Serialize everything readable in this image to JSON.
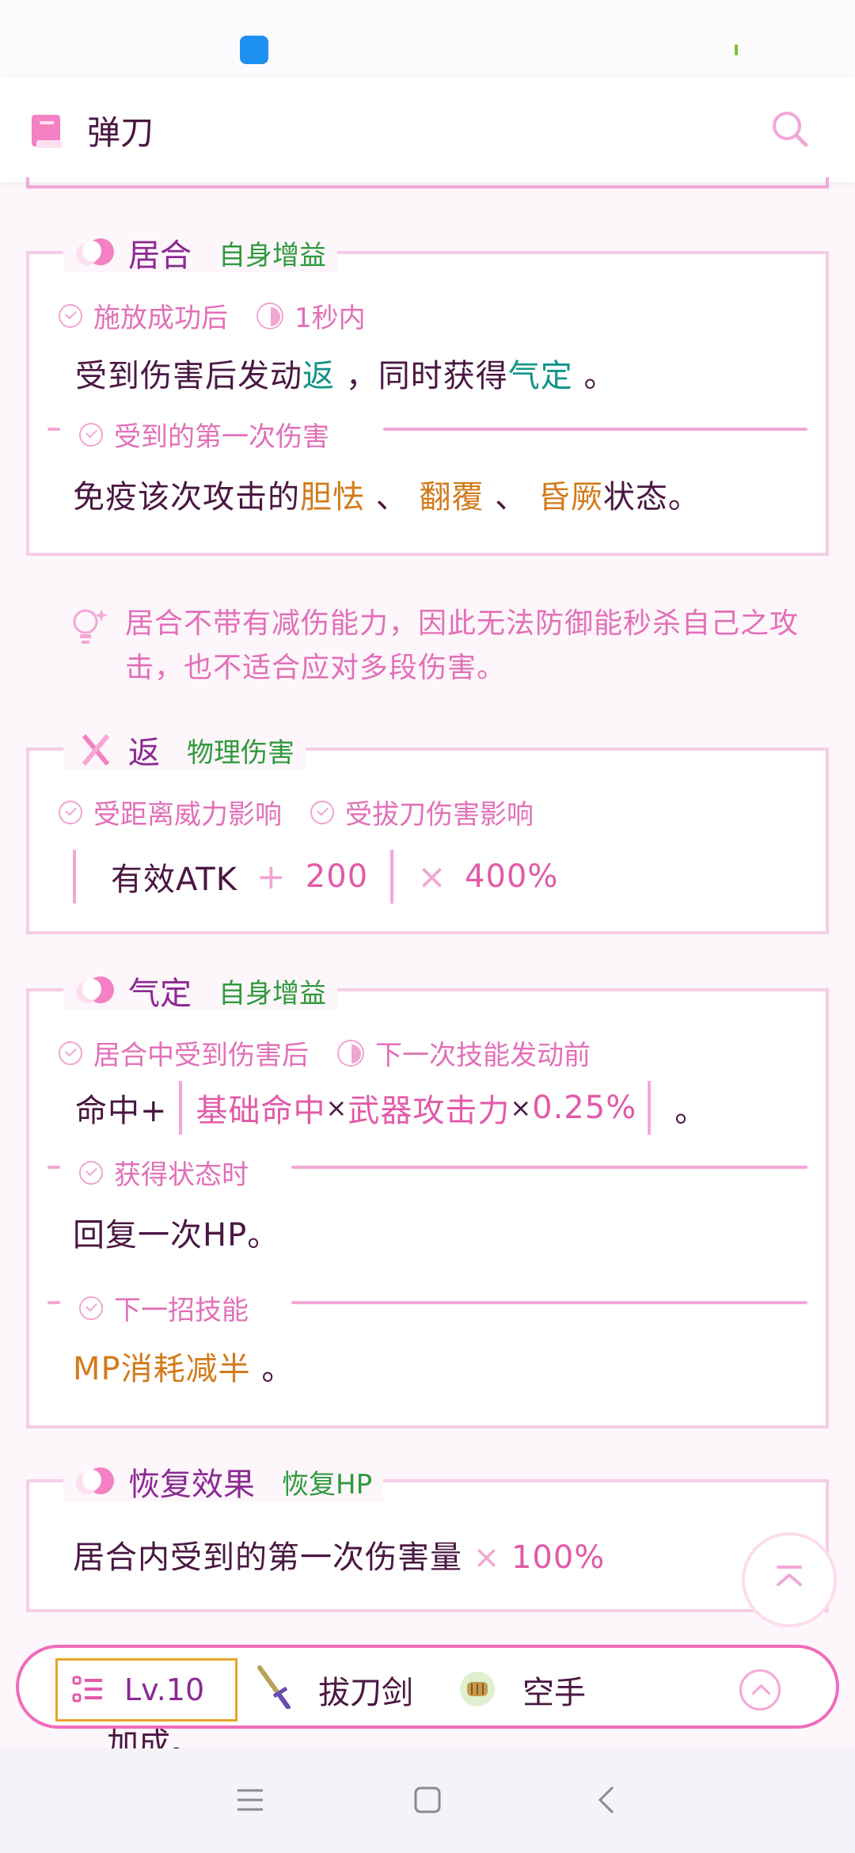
{
  "header": {
    "title": "弹刀"
  },
  "cards": [
    {
      "title": "居合",
      "tag": "自身增益",
      "conditions": [
        "施放成功后",
        "1秒内"
      ],
      "text": {
        "p1": "受到伤害后发动",
        "k1": "返",
        "p2": "，同时获得",
        "k2": "气定",
        "p3": "。"
      },
      "sub": {
        "label": "受到的第一次伤害",
        "p1": "免疫该次攻击的",
        "s1": "胆怯",
        "d1": "、",
        "s2": "翻覆",
        "d2": "、",
        "s3": "昏厥",
        "p2": "状态。"
      }
    },
    {
      "title": "返",
      "tag": "物理伤害",
      "conditions": [
        "受距离威力影响",
        "受拔刀伤害影响"
      ],
      "formula": {
        "label": "有效ATK",
        "plus": "+",
        "add": "200",
        "times": "×",
        "mult": "400%"
      }
    },
    {
      "title": "气定",
      "tag": "自身增益",
      "conditions": [
        "居合中受到伤害后",
        "下一次技能发动前"
      ],
      "text": {
        "p1": "命中+",
        "f1": "基础命中",
        "x1": "×",
        "f2": "武器攻击力",
        "x2": "×",
        "f3": "0.25%",
        "end": "。"
      },
      "sub1": {
        "label": "获得状态时",
        "text": "回复一次HP。"
      },
      "sub2": {
        "label": "下一招技能",
        "t1": "MP消耗减半",
        "t2": "。"
      }
    },
    {
      "title": "恢复效果",
      "tag": "恢复HP",
      "text": {
        "p1": "居合内受到的第一次伤害量",
        "times": "×",
        "val": "100%"
      }
    }
  ],
  "tip": "居合不带有减伤能力，因此无法防御能秒杀自己之攻击，也不适合应对多段伤害。",
  "bottom": {
    "level": "Lv.10",
    "weapon1": "拔刀剑",
    "weapon2": "空手",
    "under": "加成。"
  },
  "colors": {
    "accent": "#f06cbc",
    "tag_green": "#2e9a3b",
    "teal": "#13948a",
    "orange": "#d27b1c"
  }
}
